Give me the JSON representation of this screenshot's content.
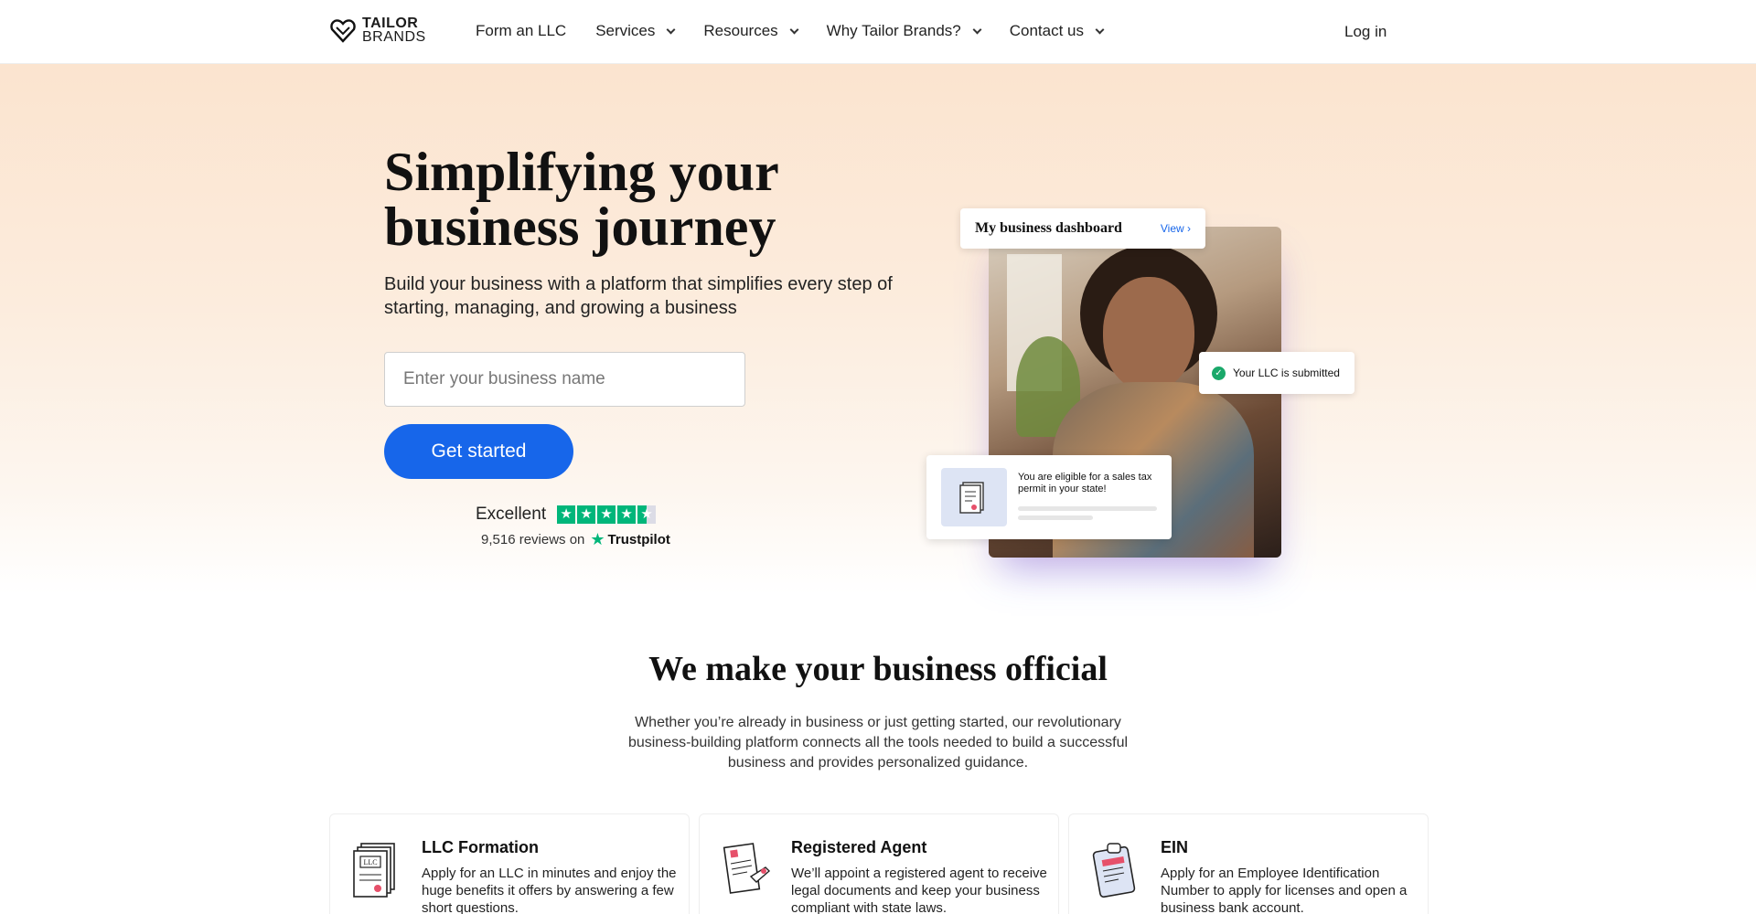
{
  "header": {
    "logo_line1": "TAILOR",
    "logo_line2": "BRANDS",
    "nav": [
      {
        "label": "Form an LLC",
        "has_dropdown": false
      },
      {
        "label": "Services",
        "has_dropdown": true
      },
      {
        "label": "Resources",
        "has_dropdown": true
      },
      {
        "label": "Why Tailor Brands?",
        "has_dropdown": true
      },
      {
        "label": "Contact us",
        "has_dropdown": true
      }
    ],
    "login_label": "Log in"
  },
  "hero": {
    "title": "Simplifying your business journey",
    "subtitle": "Build your business with a platform that simplifies every step of starting, managing, and growing a business",
    "input_placeholder": "Enter your business name",
    "cta_label": "Get started",
    "trustpilot": {
      "rating_text": "Excellent",
      "reviews_text": "9,516 reviews on",
      "brand": "Trustpilot",
      "stars": 4.5,
      "star_color": "#00b67a"
    },
    "dashboard_card": {
      "title": "My business dashboard",
      "link_label": "View"
    },
    "llc_status": "Your LLC is submitted",
    "permit_text": "You are eligible for a sales tax permit in your state!"
  },
  "section": {
    "title": "We make your business official",
    "body": "Whether you’re already in business or just getting started, our revolutionary business-building platform connects all the tools needed to build a successful business and provides personalized guidance.",
    "cards": [
      {
        "title": "LLC Formation",
        "desc": "Apply for an LLC in minutes and enjoy the huge benefits it offers by answering a few short questions.",
        "icon": "llc-certificate-icon"
      },
      {
        "title": "Registered Agent",
        "desc": "We’ll appoint a registered agent to receive legal documents and keep your business compliant with state laws.",
        "icon": "registered-agent-document-icon"
      },
      {
        "title": "EIN",
        "desc": "Apply for an Employee Identification Number to apply for licenses and open a business bank account.",
        "icon": "ein-clipboard-icon"
      }
    ]
  },
  "colors": {
    "accent": "#1766ea",
    "hero_bg": "#fbe4cf",
    "success": "#1aa86a"
  }
}
